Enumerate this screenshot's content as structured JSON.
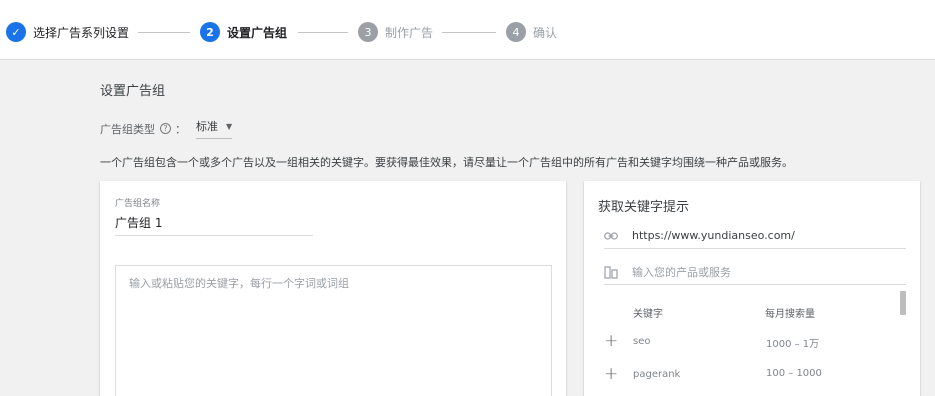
{
  "stepper": {
    "steps": [
      {
        "num": "✓",
        "label": "选择广告系列设置"
      },
      {
        "num": "2",
        "label": "设置广告组"
      },
      {
        "num": "3",
        "label": "制作广告"
      },
      {
        "num": "4",
        "label": "确认"
      }
    ]
  },
  "main": {
    "title": "设置广告组",
    "type_label": "广告组类型",
    "type_help": "?",
    "type_colon": "：",
    "type_value": "标准",
    "description": "一个广告组包含一个或多个广告以及一组相关的关键字。要获得最佳效果，请尽量让一个广告组中的所有广告和关键字均围绕一种产品或服务。"
  },
  "ad_group": {
    "name_label": "广告组名称",
    "name_value": "广告组 1",
    "keywords_placeholder": "输入或粘贴您的关键字，每行一个字词或词组"
  },
  "keyword_ideas": {
    "title": "获取关键字提示",
    "url": "https://www.yundianseo.com/",
    "product_placeholder": "输入您的产品或服务",
    "col_keyword": "关键字",
    "col_volume": "每月搜索量",
    "rows": [
      {
        "keyword": "seo",
        "volume": "1000 – 1万"
      },
      {
        "keyword": "pagerank",
        "volume": "100 – 1000"
      }
    ]
  },
  "colors": {
    "accent": "#1a73e8",
    "inactive": "#9aa0a6"
  }
}
